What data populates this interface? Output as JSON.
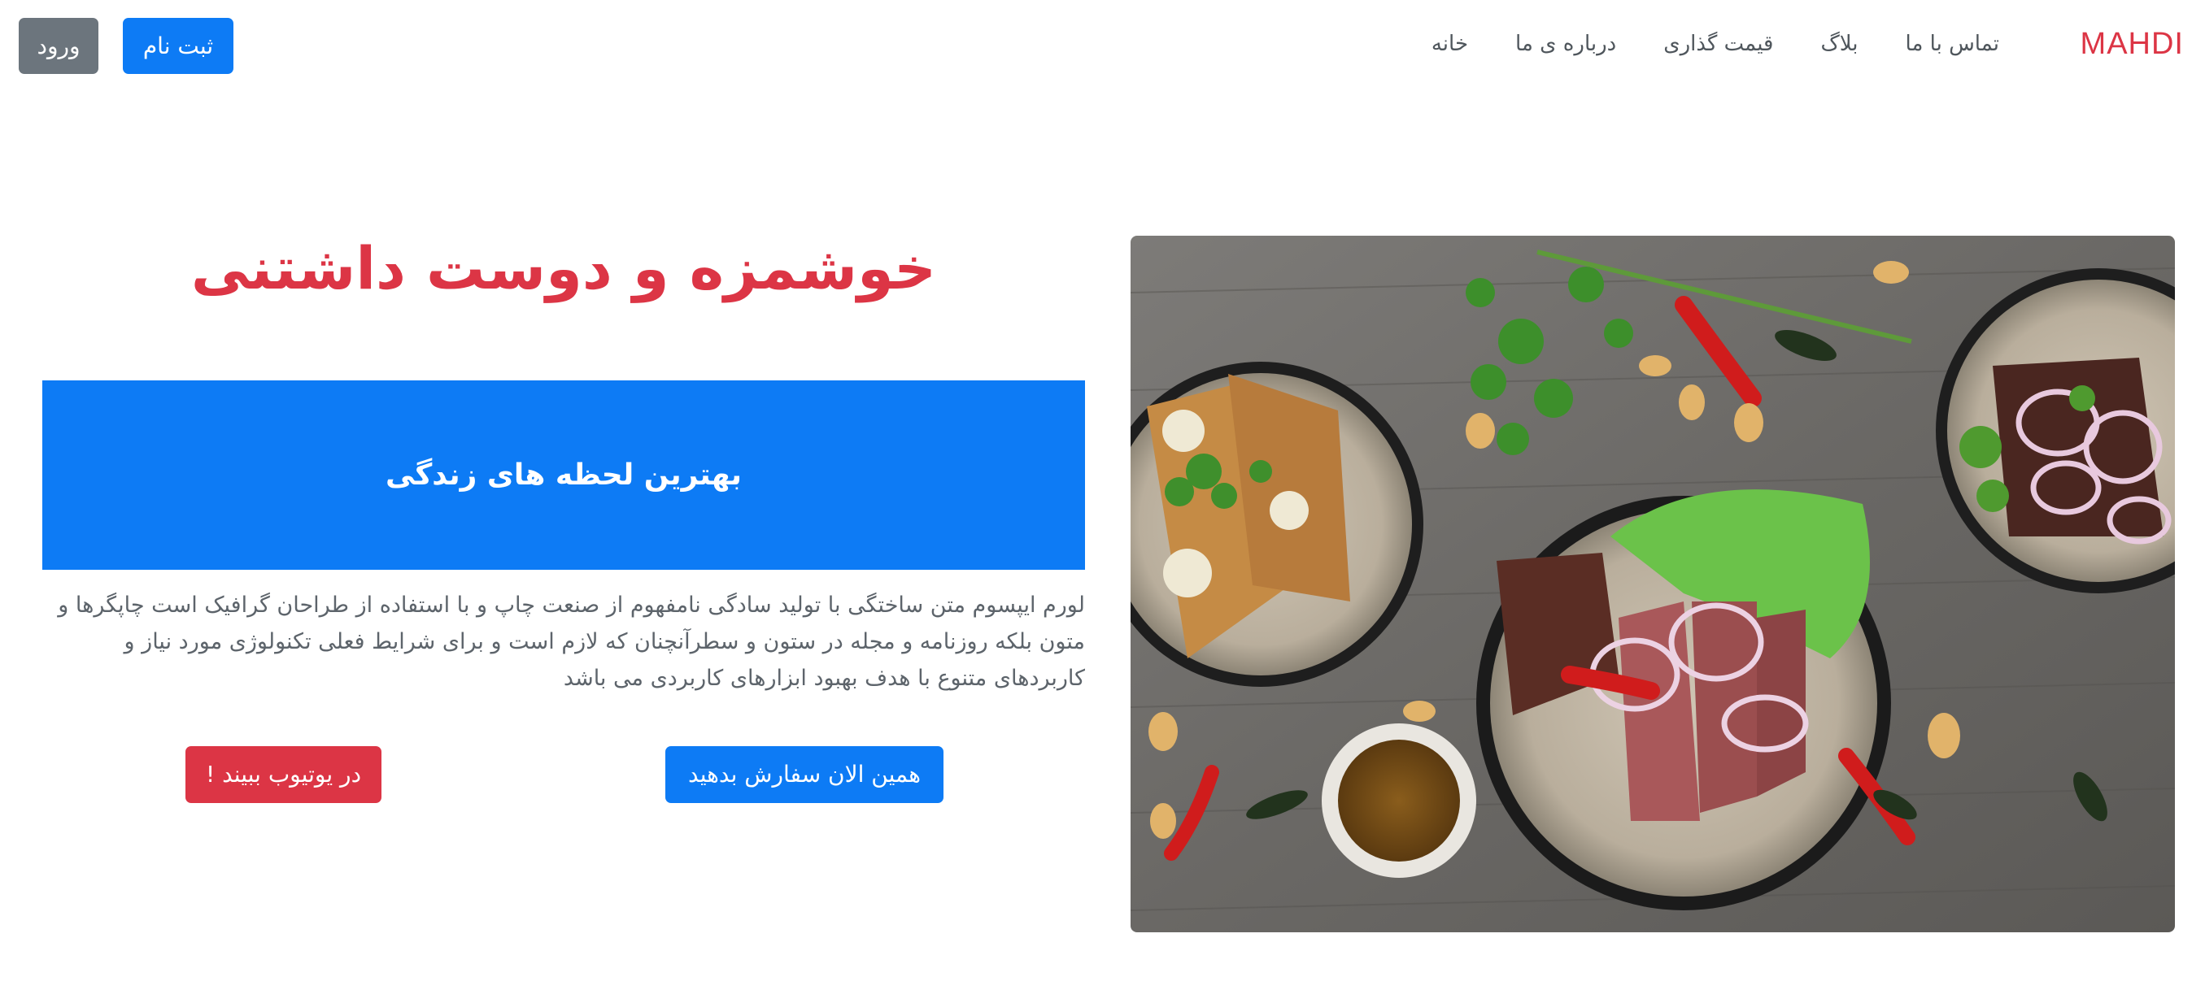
{
  "navbar": {
    "brand": "MAHDI",
    "links": [
      {
        "label": "خانه"
      },
      {
        "label": "درباره ی ما"
      },
      {
        "label": "قیمت گذاری"
      },
      {
        "label": "بلاگ"
      },
      {
        "label": "تماس با ما"
      }
    ],
    "signup_label": "ثبت نام",
    "login_label": "ورود"
  },
  "hero": {
    "title": "خوشمزه و دوست داشتنی",
    "banner_text": "بهترین لحظه های زندگی",
    "paragraph": "لورم ایپسوم متن ساختگی با تولید سادگی نامفهوم از صنعت چاپ و با استفاده از طراحان گرافیک است چاپگرها و متون بلکه روزنامه و مجله در ستون و سطرآنچنان که لازم است و برای شرایط فعلی تکنولوژی مورد نیاز و کاربردهای متنوع با هدف بهبود ابزارهای کاربردی می باشد",
    "order_button": "همین الان سفارش بدهید",
    "youtube_button": "در یوتیوب ببیند !"
  },
  "colors": {
    "brand": "#dc3545",
    "primary": "#0d7bf5",
    "secondary": "#6c757d",
    "danger": "#dc3545",
    "text_muted": "#5d646b"
  },
  "image": {
    "subject": "food-plates-photo"
  }
}
